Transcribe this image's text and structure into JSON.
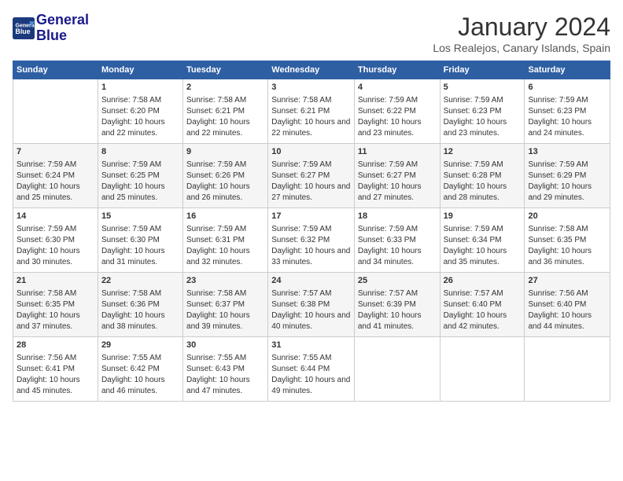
{
  "header": {
    "logo_line1": "General",
    "logo_line2": "Blue",
    "month_title": "January 2024",
    "location": "Los Realejos, Canary Islands, Spain"
  },
  "weekdays": [
    "Sunday",
    "Monday",
    "Tuesday",
    "Wednesday",
    "Thursday",
    "Friday",
    "Saturday"
  ],
  "weeks": [
    [
      {
        "day": "",
        "sunrise": "",
        "sunset": "",
        "daylight": ""
      },
      {
        "day": "1",
        "sunrise": "Sunrise: 7:58 AM",
        "sunset": "Sunset: 6:20 PM",
        "daylight": "Daylight: 10 hours and 22 minutes."
      },
      {
        "day": "2",
        "sunrise": "Sunrise: 7:58 AM",
        "sunset": "Sunset: 6:21 PM",
        "daylight": "Daylight: 10 hours and 22 minutes."
      },
      {
        "day": "3",
        "sunrise": "Sunrise: 7:58 AM",
        "sunset": "Sunset: 6:21 PM",
        "daylight": "Daylight: 10 hours and 22 minutes."
      },
      {
        "day": "4",
        "sunrise": "Sunrise: 7:59 AM",
        "sunset": "Sunset: 6:22 PM",
        "daylight": "Daylight: 10 hours and 23 minutes."
      },
      {
        "day": "5",
        "sunrise": "Sunrise: 7:59 AM",
        "sunset": "Sunset: 6:23 PM",
        "daylight": "Daylight: 10 hours and 23 minutes."
      },
      {
        "day": "6",
        "sunrise": "Sunrise: 7:59 AM",
        "sunset": "Sunset: 6:23 PM",
        "daylight": "Daylight: 10 hours and 24 minutes."
      }
    ],
    [
      {
        "day": "7",
        "sunrise": "Sunrise: 7:59 AM",
        "sunset": "Sunset: 6:24 PM",
        "daylight": "Daylight: 10 hours and 25 minutes."
      },
      {
        "day": "8",
        "sunrise": "Sunrise: 7:59 AM",
        "sunset": "Sunset: 6:25 PM",
        "daylight": "Daylight: 10 hours and 25 minutes."
      },
      {
        "day": "9",
        "sunrise": "Sunrise: 7:59 AM",
        "sunset": "Sunset: 6:26 PM",
        "daylight": "Daylight: 10 hours and 26 minutes."
      },
      {
        "day": "10",
        "sunrise": "Sunrise: 7:59 AM",
        "sunset": "Sunset: 6:27 PM",
        "daylight": "Daylight: 10 hours and 27 minutes."
      },
      {
        "day": "11",
        "sunrise": "Sunrise: 7:59 AM",
        "sunset": "Sunset: 6:27 PM",
        "daylight": "Daylight: 10 hours and 27 minutes."
      },
      {
        "day": "12",
        "sunrise": "Sunrise: 7:59 AM",
        "sunset": "Sunset: 6:28 PM",
        "daylight": "Daylight: 10 hours and 28 minutes."
      },
      {
        "day": "13",
        "sunrise": "Sunrise: 7:59 AM",
        "sunset": "Sunset: 6:29 PM",
        "daylight": "Daylight: 10 hours and 29 minutes."
      }
    ],
    [
      {
        "day": "14",
        "sunrise": "Sunrise: 7:59 AM",
        "sunset": "Sunset: 6:30 PM",
        "daylight": "Daylight: 10 hours and 30 minutes."
      },
      {
        "day": "15",
        "sunrise": "Sunrise: 7:59 AM",
        "sunset": "Sunset: 6:30 PM",
        "daylight": "Daylight: 10 hours and 31 minutes."
      },
      {
        "day": "16",
        "sunrise": "Sunrise: 7:59 AM",
        "sunset": "Sunset: 6:31 PM",
        "daylight": "Daylight: 10 hours and 32 minutes."
      },
      {
        "day": "17",
        "sunrise": "Sunrise: 7:59 AM",
        "sunset": "Sunset: 6:32 PM",
        "daylight": "Daylight: 10 hours and 33 minutes."
      },
      {
        "day": "18",
        "sunrise": "Sunrise: 7:59 AM",
        "sunset": "Sunset: 6:33 PM",
        "daylight": "Daylight: 10 hours and 34 minutes."
      },
      {
        "day": "19",
        "sunrise": "Sunrise: 7:59 AM",
        "sunset": "Sunset: 6:34 PM",
        "daylight": "Daylight: 10 hours and 35 minutes."
      },
      {
        "day": "20",
        "sunrise": "Sunrise: 7:58 AM",
        "sunset": "Sunset: 6:35 PM",
        "daylight": "Daylight: 10 hours and 36 minutes."
      }
    ],
    [
      {
        "day": "21",
        "sunrise": "Sunrise: 7:58 AM",
        "sunset": "Sunset: 6:35 PM",
        "daylight": "Daylight: 10 hours and 37 minutes."
      },
      {
        "day": "22",
        "sunrise": "Sunrise: 7:58 AM",
        "sunset": "Sunset: 6:36 PM",
        "daylight": "Daylight: 10 hours and 38 minutes."
      },
      {
        "day": "23",
        "sunrise": "Sunrise: 7:58 AM",
        "sunset": "Sunset: 6:37 PM",
        "daylight": "Daylight: 10 hours and 39 minutes."
      },
      {
        "day": "24",
        "sunrise": "Sunrise: 7:57 AM",
        "sunset": "Sunset: 6:38 PM",
        "daylight": "Daylight: 10 hours and 40 minutes."
      },
      {
        "day": "25",
        "sunrise": "Sunrise: 7:57 AM",
        "sunset": "Sunset: 6:39 PM",
        "daylight": "Daylight: 10 hours and 41 minutes."
      },
      {
        "day": "26",
        "sunrise": "Sunrise: 7:57 AM",
        "sunset": "Sunset: 6:40 PM",
        "daylight": "Daylight: 10 hours and 42 minutes."
      },
      {
        "day": "27",
        "sunrise": "Sunrise: 7:56 AM",
        "sunset": "Sunset: 6:40 PM",
        "daylight": "Daylight: 10 hours and 44 minutes."
      }
    ],
    [
      {
        "day": "28",
        "sunrise": "Sunrise: 7:56 AM",
        "sunset": "Sunset: 6:41 PM",
        "daylight": "Daylight: 10 hours and 45 minutes."
      },
      {
        "day": "29",
        "sunrise": "Sunrise: 7:55 AM",
        "sunset": "Sunset: 6:42 PM",
        "daylight": "Daylight: 10 hours and 46 minutes."
      },
      {
        "day": "30",
        "sunrise": "Sunrise: 7:55 AM",
        "sunset": "Sunset: 6:43 PM",
        "daylight": "Daylight: 10 hours and 47 minutes."
      },
      {
        "day": "31",
        "sunrise": "Sunrise: 7:55 AM",
        "sunset": "Sunset: 6:44 PM",
        "daylight": "Daylight: 10 hours and 49 minutes."
      },
      {
        "day": "",
        "sunrise": "",
        "sunset": "",
        "daylight": ""
      },
      {
        "day": "",
        "sunrise": "",
        "sunset": "",
        "daylight": ""
      },
      {
        "day": "",
        "sunrise": "",
        "sunset": "",
        "daylight": ""
      }
    ]
  ]
}
